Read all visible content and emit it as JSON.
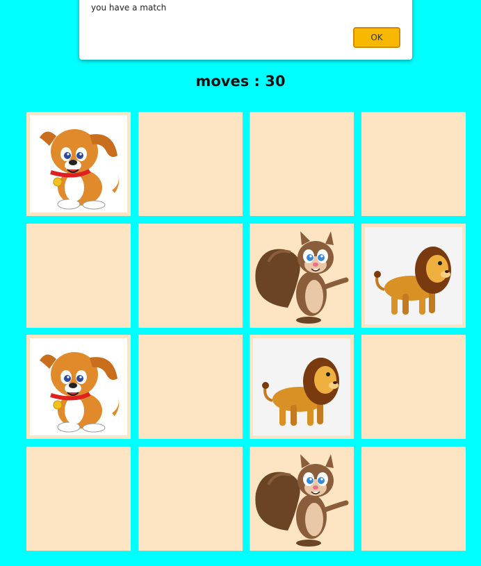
{
  "alert": {
    "message": "you have a match",
    "ok_label": "OK"
  },
  "status": {
    "moves_text": "moves : 30"
  },
  "colors": {
    "page_background": "#00ffff",
    "card_back": "#fde5c4",
    "ok_button": "#f9b800"
  },
  "board": {
    "rows": 4,
    "columns": 4,
    "cards": [
      {
        "state": "face-up",
        "animal": "dog"
      },
      {
        "state": "face-down"
      },
      {
        "state": "face-down"
      },
      {
        "state": "face-down"
      },
      {
        "state": "face-down"
      },
      {
        "state": "face-down"
      },
      {
        "state": "face-up",
        "animal": "squirrel"
      },
      {
        "state": "face-up",
        "animal": "lion"
      },
      {
        "state": "face-up",
        "animal": "dog"
      },
      {
        "state": "face-down"
      },
      {
        "state": "face-up",
        "animal": "lion"
      },
      {
        "state": "face-down"
      },
      {
        "state": "face-down"
      },
      {
        "state": "face-down"
      },
      {
        "state": "face-up",
        "animal": "squirrel"
      },
      {
        "state": "face-down"
      }
    ]
  }
}
